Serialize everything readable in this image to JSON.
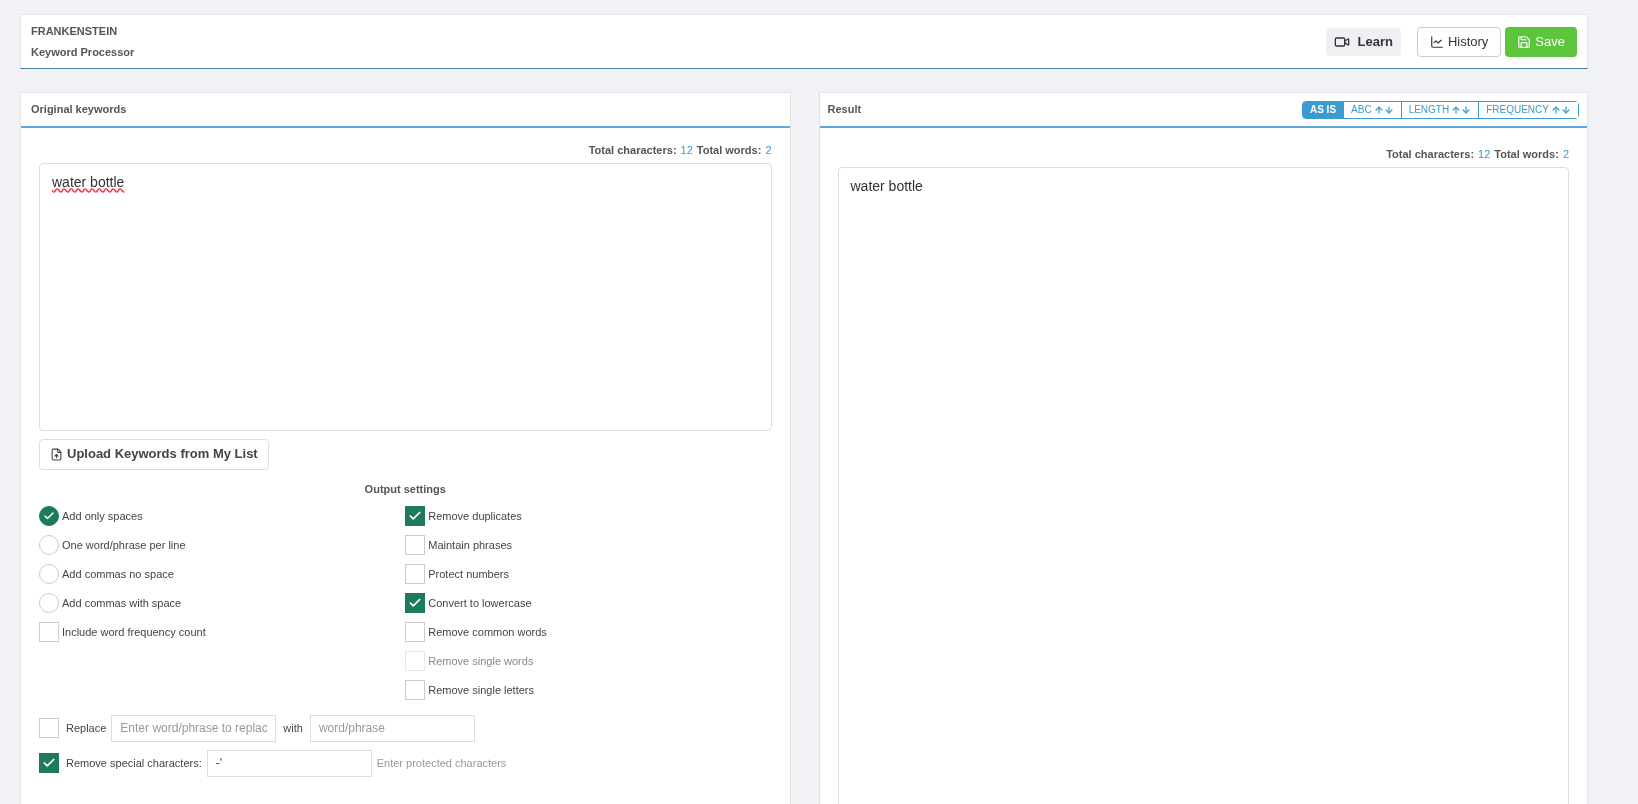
{
  "header": {
    "title": "FRANKENSTEIN",
    "subtitle": "Keyword Processor",
    "buttons": [
      {
        "kind": "learn",
        "label": "Learn"
      },
      {
        "kind": "history",
        "label": "History"
      },
      {
        "kind": "save",
        "label": "Save"
      }
    ]
  },
  "original": {
    "title": "Original keywords",
    "stats": {
      "chars_label": "Total characters:",
      "chars": "12",
      "words_label": "Total words:",
      "words": "2"
    },
    "value": "water bottle",
    "upload": "Upload Keywords from My List",
    "settings_title": "Output settings",
    "left_options": [
      {
        "kind": "radio",
        "label": "Add only spaces",
        "checked": true
      },
      {
        "kind": "radio",
        "label": "One word/phrase per line",
        "checked": false
      },
      {
        "kind": "radio",
        "label": "Add commas no space",
        "checked": false
      },
      {
        "kind": "radio",
        "label": "Add commas with space",
        "checked": false
      },
      {
        "kind": "checkbox",
        "label": "Include word frequency count",
        "checked": false
      }
    ],
    "right_options": [
      {
        "label": "Remove duplicates",
        "checked": true,
        "disabled": false
      },
      {
        "label": "Maintain phrases",
        "checked": false,
        "disabled": false
      },
      {
        "label": "Protect numbers",
        "checked": false,
        "disabled": false
      },
      {
        "label": "Convert to lowercase",
        "checked": true,
        "disabled": false
      },
      {
        "label": "Remove common words",
        "checked": false,
        "disabled": false
      },
      {
        "label": "Remove single words",
        "checked": false,
        "disabled": true
      },
      {
        "label": "Remove single letters",
        "checked": false,
        "disabled": false
      }
    ],
    "replace": {
      "checked": false,
      "label": "Replace",
      "placeholder": "Enter word/phrase to replac",
      "with": "with",
      "with_placeholder": "word/phrase"
    },
    "special": {
      "checked": true,
      "label": "Remove special characters:",
      "value": "-'",
      "hint": "Enter protected characters"
    }
  },
  "result": {
    "title": "Result",
    "sort_tabs": [
      {
        "label": "AS IS",
        "arrows": false,
        "selected": true
      },
      {
        "label": "ABC",
        "arrows": true,
        "selected": false
      },
      {
        "label": "LENGTH",
        "arrows": true,
        "selected": false
      },
      {
        "label": "FREQUENCY",
        "arrows": true,
        "selected": false
      }
    ],
    "stats": {
      "chars_label": "Total characters:",
      "chars": "12",
      "words_label": "Total words:",
      "words": "2"
    },
    "value": "water bottle"
  }
}
